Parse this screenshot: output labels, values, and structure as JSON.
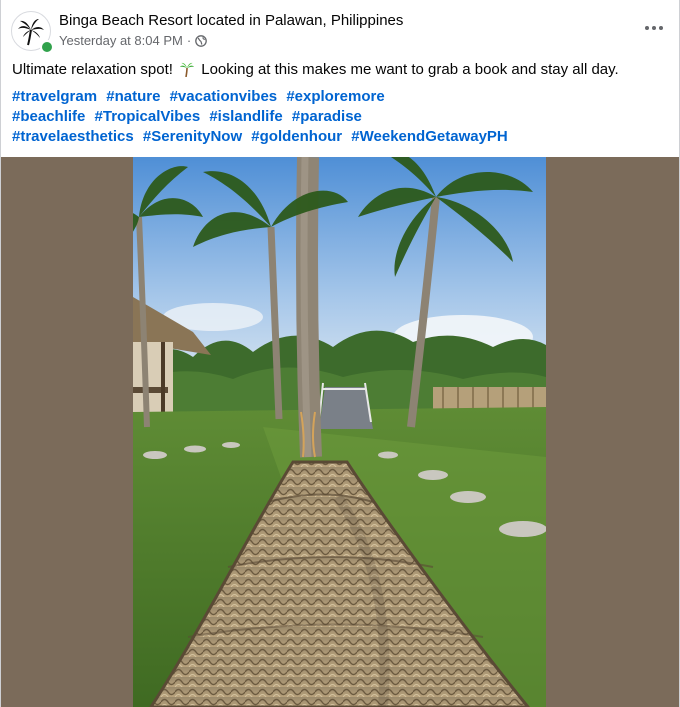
{
  "post": {
    "page_name": "Binga Beach Resort located in Palawan, Philippines",
    "timestamp": "Yesterday at 8:04 PM",
    "separator": "·",
    "audience_icon": "globe-icon",
    "more_icon": "more-options-icon",
    "caption_before": "Ultimate relaxation spot!",
    "caption_emoji_icon": "palm-tree-emoji",
    "caption_after": "Looking at this makes me want to grab a book and stay all day.",
    "hashtag_rows": [
      [
        "#travelgram",
        "#nature",
        "#vacationvibes",
        "#exploremore"
      ],
      [
        "#beachlife",
        "#TropicalVibes",
        "#islandlife",
        "#paradise"
      ],
      [
        "#travelaesthetics",
        "#SerenityNow",
        "#goldenhour",
        "#WeekendGetawayPH"
      ]
    ]
  },
  "colors": {
    "hashtag": "#0064d1",
    "meta_text": "#65676b",
    "online_status": "#31a24c",
    "media_backdrop": "#7b6b5a"
  }
}
